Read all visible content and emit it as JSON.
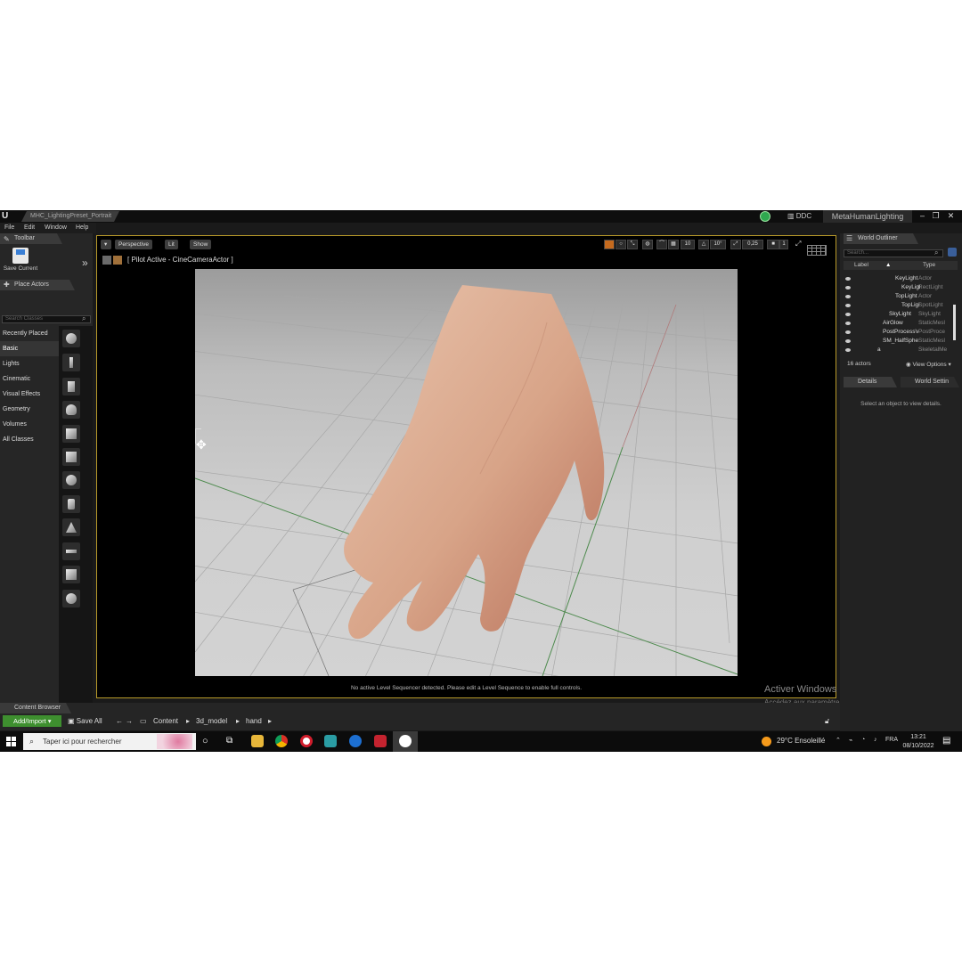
{
  "window": {
    "document_tab": "MHC_LightingPreset_Portrait",
    "ddc_label": "DDC",
    "project_title": "MetaHumanLighting",
    "controls": [
      "–",
      "❐",
      "✕"
    ]
  },
  "menu": [
    "File",
    "Edit",
    "Window",
    "Help"
  ],
  "left_panel": {
    "toolbar_tab": "Toolbar",
    "save_current": "Save Current",
    "place_actors_tab": "Place Actors",
    "search_placeholder": "Search Classes",
    "categories": [
      "Recently Placed",
      "Basic",
      "Lights",
      "Cinematic",
      "Visual Effects",
      "Geometry",
      "Volumes",
      "All Classes"
    ],
    "active_category": "Basic"
  },
  "viewport": {
    "perspective_label": "Perspective",
    "lit_label": "Lit",
    "show_label": "Show",
    "snap_grid": "10",
    "snap_rotation": "10°",
    "snap_scale": "0,25",
    "camera_speed": "1",
    "pilot_text": "[ Pilot Active - CineCameraActor ]",
    "sequencer_message": "No active Level Sequencer detected. Please edit a Level Sequence to enable full controls."
  },
  "watermark": {
    "title": "Activer Windows",
    "subtitle": "Accédez aux paramètres pour activer Windows."
  },
  "world_outliner": {
    "tab": "World Outliner",
    "search_placeholder": "Search...",
    "col_label": "Label",
    "col_type": "Type",
    "rows": [
      {
        "label": "KeyLight",
        "type": "Actor"
      },
      {
        "label": "KeyLigl",
        "type": "RectLight"
      },
      {
        "label": "TopLight",
        "type": "Actor"
      },
      {
        "label": "TopLigl",
        "type": "SpotLight"
      },
      {
        "label": "SkyLight",
        "type": "SkyLight"
      },
      {
        "label": "AirGlow",
        "type": "StaticMesl"
      },
      {
        "label": "PostProcessV",
        "type": "PostProce"
      },
      {
        "label": "SM_HalfSpher",
        "type": "StaticMesl"
      },
      {
        "label": "a",
        "type": "SkeletalMe"
      }
    ],
    "actor_count": "16 actors",
    "view_options": "View Options"
  },
  "details": {
    "tab": "Details",
    "world_settings_tab": "World Settin",
    "empty_message": "Select an object to view details."
  },
  "content_browser": {
    "tab": "Content Browser",
    "add_import": "Add/Import",
    "save_all": "Save All",
    "path": [
      "Content",
      "3d_model",
      "hand"
    ]
  },
  "taskbar": {
    "search_placeholder": "Taper ici pour rechercher",
    "weather": "29°C  Ensoleillé",
    "language": "FRA",
    "time": "13:21",
    "date": "08/10/2022"
  },
  "colors": {
    "accent_green": "#3e8f2f",
    "viewport_border": "#b89a2a",
    "panel_bg": "#262626"
  }
}
